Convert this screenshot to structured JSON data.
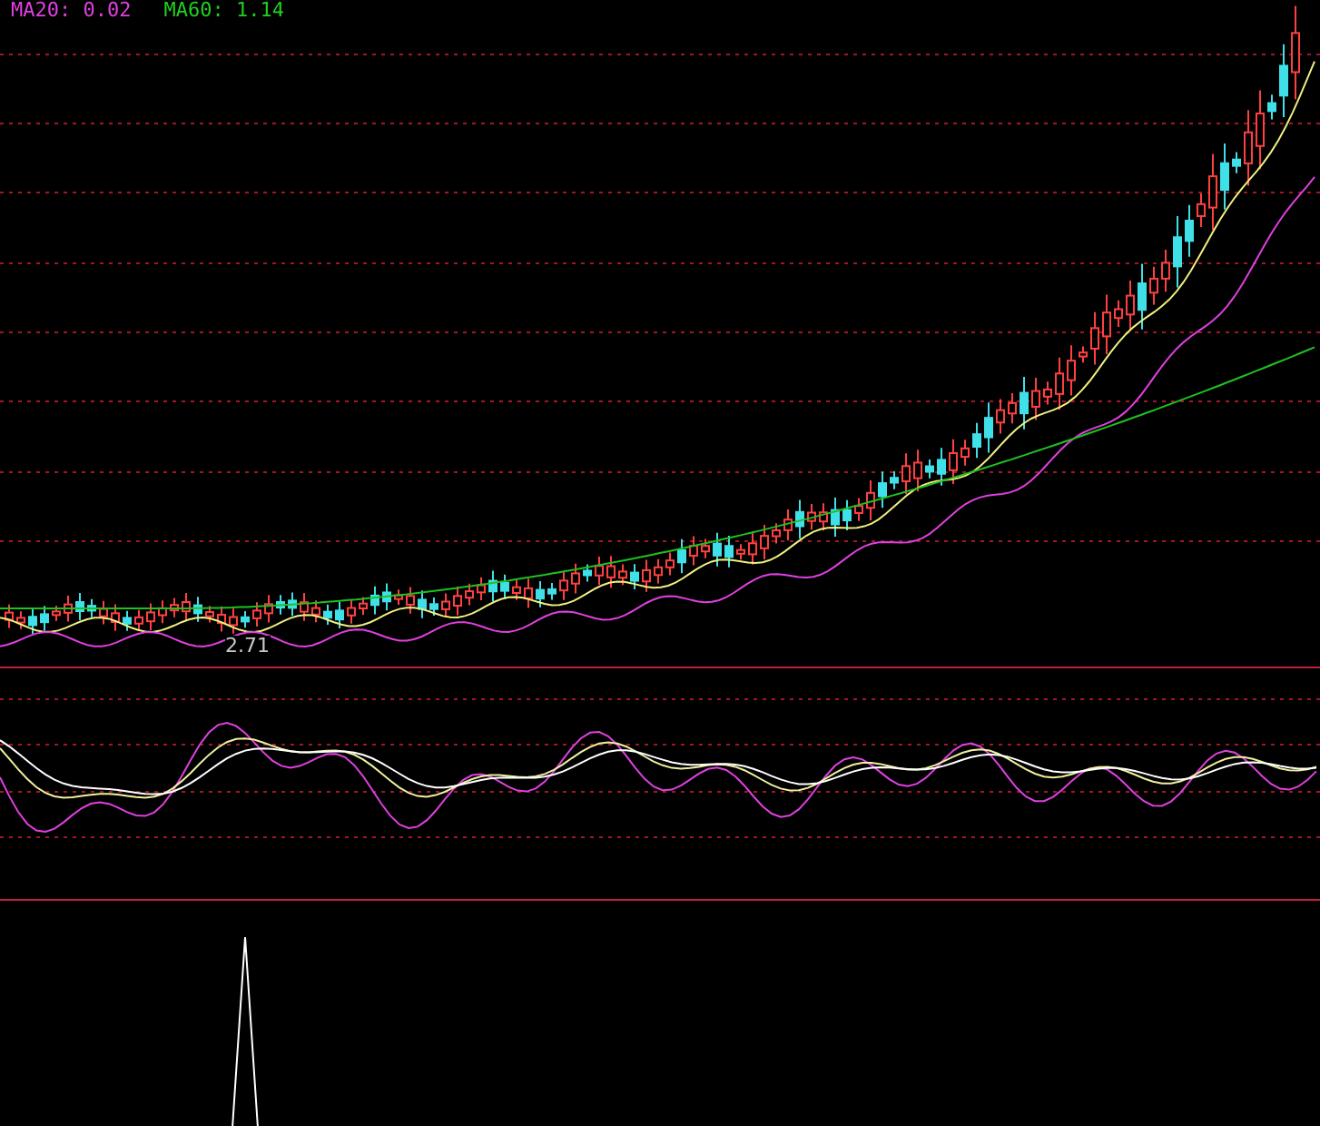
{
  "legend": [
    {
      "label": "MA20: 0.02",
      "color": "#e040e0"
    },
    {
      "label": "MA60: 1.14",
      "color": "#20d020"
    }
  ],
  "price_chart": {
    "low_label": "2.71"
  }
}
